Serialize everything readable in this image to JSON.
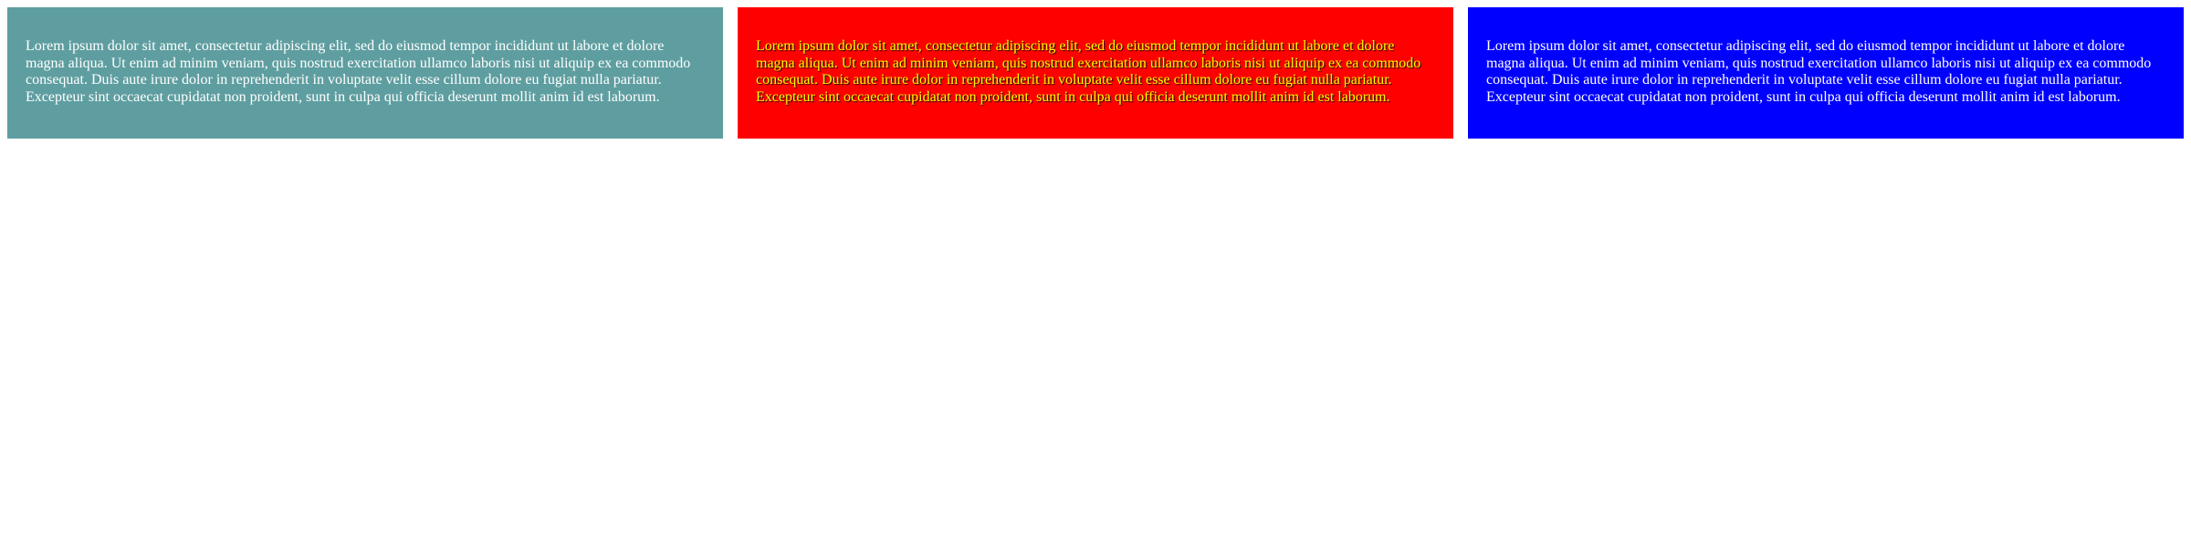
{
  "panels": [
    {
      "color": "#5f9ea0",
      "text": "Lorem ipsum dolor sit amet, consectetur adipiscing elit, sed do eiusmod tempor incididunt ut labore et dolore magna aliqua. Ut enim ad minim veniam, quis nostrud exercitation ullamco laboris nisi ut aliquip ex ea commodo consequat. Duis aute irure dolor in reprehenderit in voluptate velit esse cillum dolore eu fugiat nulla pariatur. Excepteur sint occaecat cupidatat non proident, sunt in culpa qui officia deserunt mollit anim id est laborum."
    },
    {
      "color": "#ff0000",
      "text_color": "#ffff00",
      "text": "Lorem ipsum dolor sit amet, consectetur adipiscing elit, sed do eiusmod tempor incididunt ut labore et dolore magna aliqua. Ut enim ad minim veniam, quis nostrud exercitation ullamco laboris nisi ut aliquip ex ea commodo consequat. Duis aute irure dolor in reprehenderit in voluptate velit esse cillum dolore eu fugiat nulla pariatur. Excepteur sint occaecat cupidatat non proident, sunt in culpa qui officia deserunt mollit anim id est laborum."
    },
    {
      "color": "#0000ff",
      "text": "Lorem ipsum dolor sit amet, consectetur adipiscing elit, sed do eiusmod tempor incididunt ut labore et dolore magna aliqua. Ut enim ad minim veniam, quis nostrud exercitation ullamco laboris nisi ut aliquip ex ea commodo consequat. Duis aute irure dolor in reprehenderit in voluptate velit esse cillum dolore eu fugiat nulla pariatur. Excepteur sint occaecat cupidatat non proident, sunt in culpa qui officia deserunt mollit anim id est laborum."
    }
  ]
}
